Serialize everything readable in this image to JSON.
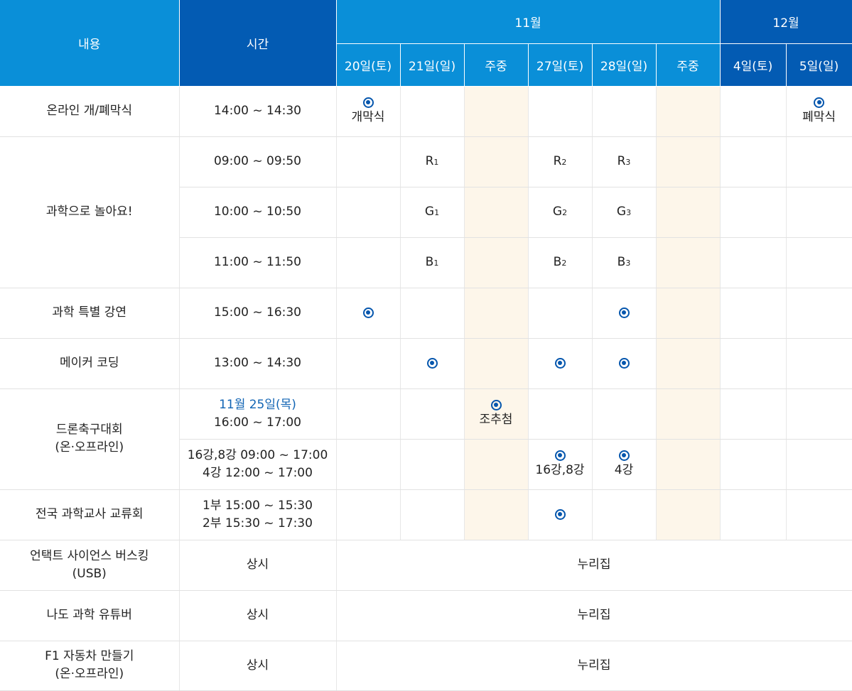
{
  "header": {
    "col_content": "내용",
    "col_time": "시간",
    "month_nov": "11월",
    "month_dec": "12월",
    "days": [
      "20일(토)",
      "21일(일)",
      "주중",
      "27일(토)",
      "28일(일)",
      "주중",
      "4일(토)",
      "5일(일)"
    ]
  },
  "rows": {
    "ceremony": {
      "name": "온라인 개/폐막식",
      "time": "14:00 ~ 14:30",
      "open_label": "개막식",
      "close_label": "폐막식"
    },
    "science_play": {
      "name": "과학으로 놀아요!",
      "sessions": [
        {
          "time": "09:00 ~ 09:50",
          "letter": "R"
        },
        {
          "time": "10:00 ~ 10:50",
          "letter": "G"
        },
        {
          "time": "11:00 ~ 11:50",
          "letter": "B"
        }
      ],
      "subs": [
        "1",
        "2",
        "3"
      ]
    },
    "lecture": {
      "name": "과학 특별 강연",
      "time": "15:00 ~ 16:30"
    },
    "maker": {
      "name": "메이커 코딩",
      "time": "13:00 ~ 14:30"
    },
    "drone": {
      "name_line1": "드론축구대회",
      "name_line2": "(온·오프라인)",
      "draw_date": "11월 25일(목)",
      "draw_time": "16:00 ~ 17:00",
      "draw_label": "조추첨",
      "match_line1": "16강,8강 09:00 ~ 17:00",
      "match_line2": "4강 12:00 ~ 17:00",
      "match_label_27": "16강,8강",
      "match_label_28": "4강"
    },
    "teachers": {
      "name": "전국 과학교사 교류회",
      "line1": "1부 15:00 ~ 15:30",
      "line2": "2부 15:30 ~ 17:30"
    },
    "busking": {
      "name_line1": "언택트 사이언스 버스킹",
      "name_line2": "(USB)",
      "time": "상시",
      "place": "누리집"
    },
    "youtuber": {
      "name": "나도 과학 유튜버",
      "time": "상시",
      "place": "누리집"
    },
    "f1": {
      "name_line1": "F1 자동차 만들기",
      "name_line2": "(온·오프라인)",
      "time": "상시",
      "place": "누리집"
    }
  },
  "colors": {
    "header_light": "#0a8fd8",
    "header_dark": "#035bb3",
    "weekday_bg": "#fdf6ea",
    "mark": "#0556ad",
    "highlight_text": "#1164b4"
  },
  "icons": {
    "mark": "filled-circle-mark-icon"
  }
}
